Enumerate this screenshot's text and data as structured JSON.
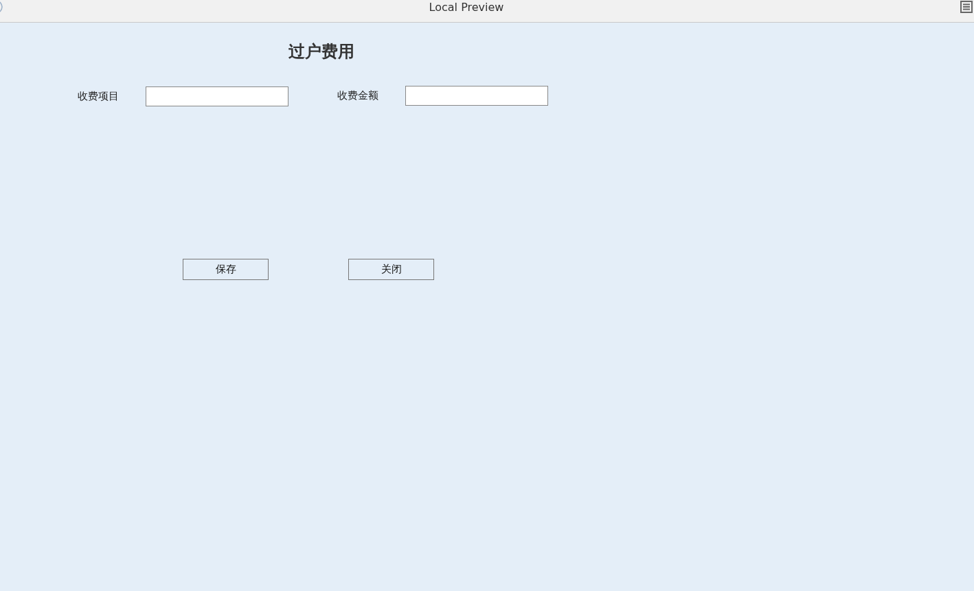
{
  "window": {
    "title": "Local Preview"
  },
  "form": {
    "title": "过户费用",
    "fields": [
      {
        "label": "收费项目"
      },
      {
        "label": "收费金额"
      }
    ],
    "buttons": [
      "保存",
      "关闭"
    ]
  }
}
